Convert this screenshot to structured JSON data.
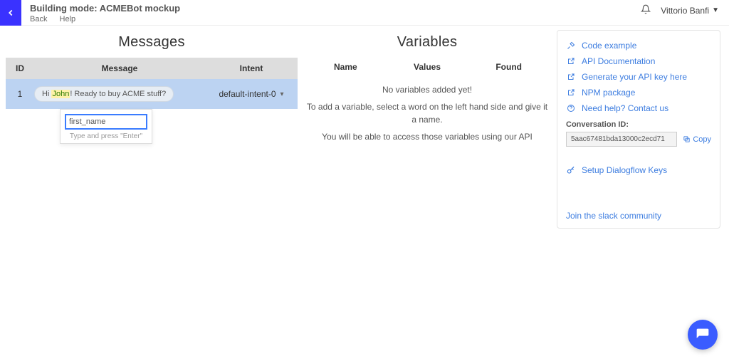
{
  "topbar": {
    "title": "Building mode: ACMEBot mockup",
    "crumbs": {
      "back": "Back",
      "help": "Help"
    },
    "user": "Vittorio Banfi"
  },
  "messages": {
    "title": "Messages",
    "headers": {
      "id": "ID",
      "message": "Message",
      "intent": "Intent"
    },
    "row": {
      "id": "1",
      "prefix": "Hi ",
      "highlight": "John",
      "suffix": "! Ready to buy ACME stuff?",
      "intent": "default-intent-0"
    },
    "popover": {
      "value": "first_name",
      "hint": "Type and press \"Enter\""
    }
  },
  "variables": {
    "title": "Variables",
    "headers": {
      "name": "Name",
      "values": "Values",
      "found": "Found"
    },
    "empty_title": "No variables added yet!",
    "empty_line1": "To add a variable, select a word on the left hand side and give it a name.",
    "empty_line2": "You will be able to access those variables using our API"
  },
  "side": {
    "links": {
      "code_example": "Code example",
      "api_docs": "API Documentation",
      "gen_key": "Generate your API key here",
      "npm": "NPM package",
      "help": "Need help? Contact us"
    },
    "conv_label": "Conversation ID:",
    "conv_id": "5aac67481bda13000c2ecd71",
    "copy": "Copy",
    "setup": "Setup Dialogflow Keys",
    "slack": "Join the slack community"
  }
}
